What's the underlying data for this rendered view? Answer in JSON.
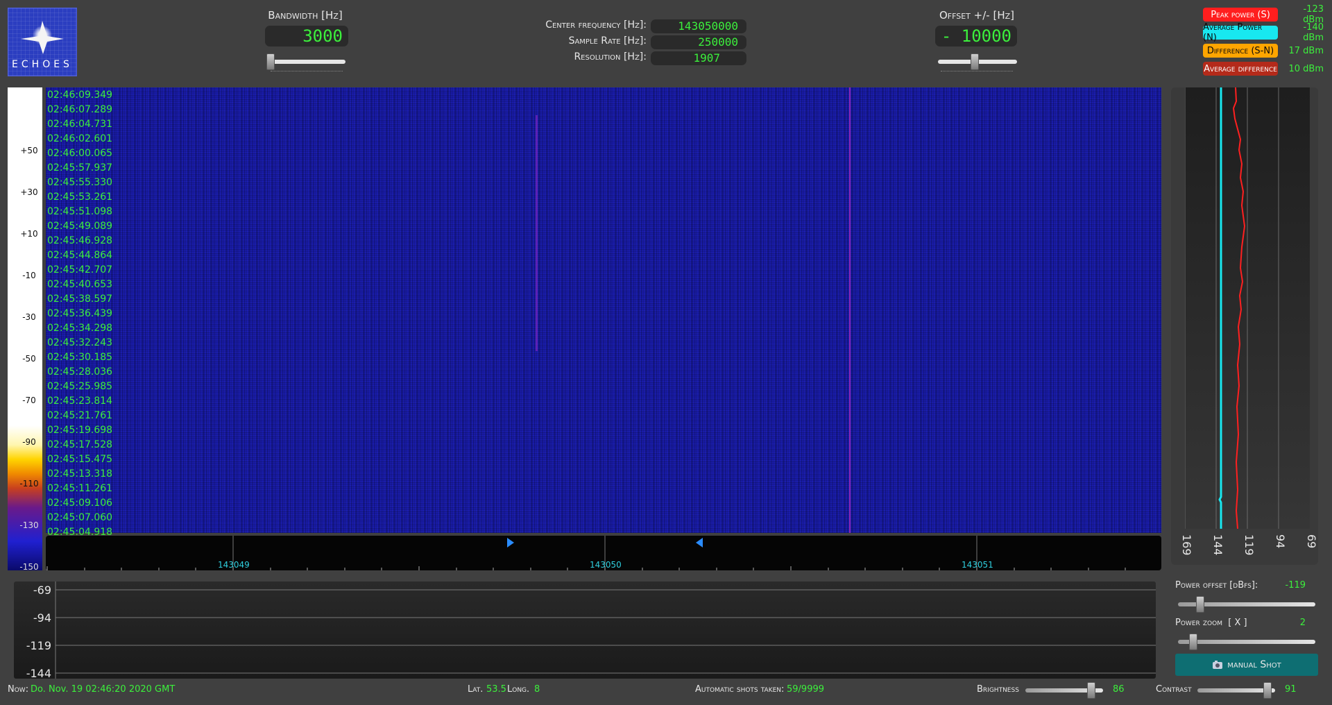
{
  "logo": {
    "text": "ECHOES"
  },
  "bandwidth": {
    "label": "Bandwidth [Hz]",
    "value": "3000"
  },
  "center": {
    "freq_label": "Center frequency [Hz]:",
    "freq_value": "143050000",
    "rate_label": "Sample Rate [Hz]:",
    "rate_value": "250000",
    "res_label": "Resolution [Hz]:",
    "res_value": "1907"
  },
  "offset": {
    "label": "Offset +/- [Hz]",
    "value": "- 10000"
  },
  "legend": [
    {
      "label": "Peak power (S)",
      "value": "-123 dBm",
      "color": "#ff1e1e",
      "text": "#ffffff"
    },
    {
      "label": "Average Power (N)",
      "value": "-140 dBm",
      "color": "#18e8f0",
      "text": "#0a0a0a"
    },
    {
      "label": "Difference (S-N)",
      "value": "17 dBm",
      "color": "#ffa500",
      "text": "#0a0a0a"
    },
    {
      "label": "Average difference",
      "value": "10 dBm",
      "color": "#b42a1a",
      "text": "#ffffff"
    }
  ],
  "color_scale": [
    "+50",
    "+30",
    "+10",
    "-10",
    "-30",
    "-50",
    "-70",
    "-90",
    "-110",
    "-130",
    "-150"
  ],
  "timestamps": [
    "02:46:09.349",
    "02:46:07.289",
    "02:46:04.731",
    "02:46:02.601",
    "02:46:00.065",
    "02:45:57.937",
    "02:45:55.330",
    "02:45:53.261",
    "02:45:51.098",
    "02:45:49.089",
    "02:45:46.928",
    "02:45:44.864",
    "02:45:42.707",
    "02:45:40.653",
    "02:45:38.597",
    "02:45:36.439",
    "02:45:34.298",
    "02:45:32.243",
    "02:45:30.185",
    "02:45:28.036",
    "02:45:25.985",
    "02:45:23.814",
    "02:45:21.761",
    "02:45:19.698",
    "02:45:17.528",
    "02:45:15.475",
    "02:45:13.318",
    "02:45:11.261",
    "02:45:09.106",
    "02:45:07.060",
    "02:45:04.918"
  ],
  "freq_axis": [
    "143049",
    "143050",
    "143051"
  ],
  "side_axis": [
    "169",
    "144",
    "119",
    "94",
    "69"
  ],
  "power_axis": [
    "-69",
    "-94",
    "-119",
    "-144"
  ],
  "power_offset": {
    "label": "Power offset [dBfs]:",
    "value": "-119"
  },
  "power_zoom": {
    "label": "Power zoom  [ X ]",
    "value": "2"
  },
  "manual_shot": {
    "label": "manual Shot",
    "icon": "camera-icon"
  },
  "status": {
    "now_label": "Now:",
    "now_value": "Do. Nov. 19 02:46:20 2020 GMT",
    "lat_label": "Lat.",
    "lat_value": "53.5",
    "long_label": "Long.",
    "long_value": "8",
    "shots_label": "Automatic shots taken:",
    "shots_value": "59/9999",
    "brightness_label": "Brightness",
    "brightness_value": "86",
    "contrast_label": "Contrast",
    "contrast_value": "91"
  }
}
